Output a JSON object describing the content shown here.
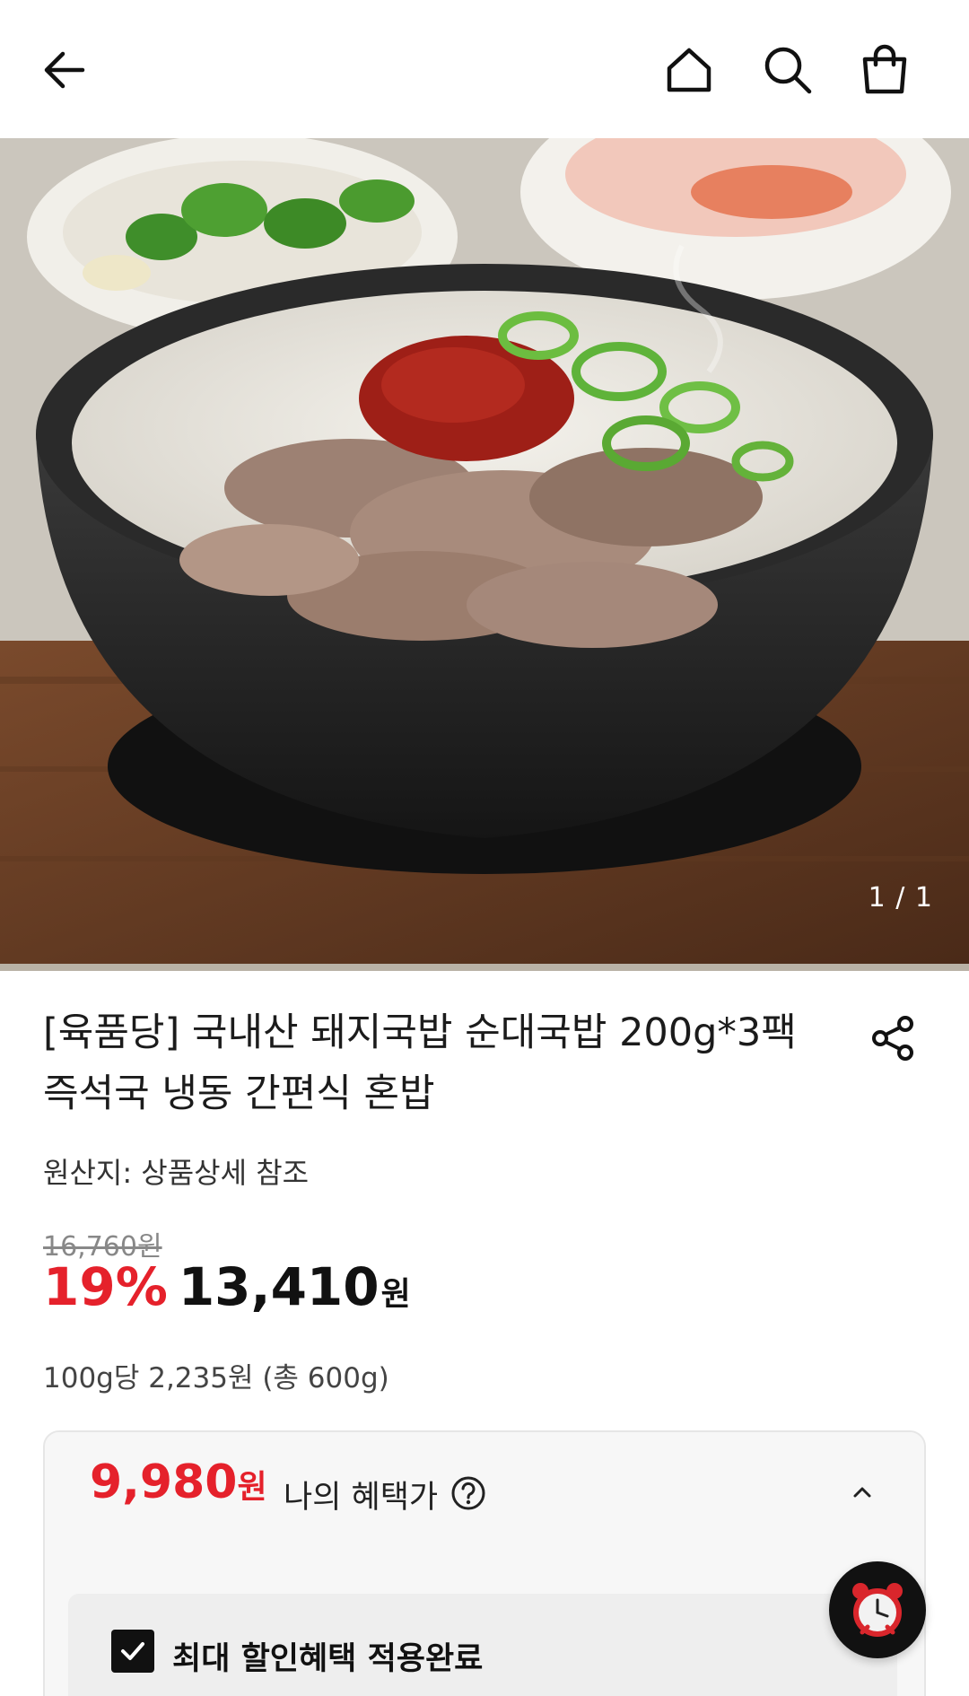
{
  "header": {
    "icons": [
      "back-arrow-icon",
      "home-icon",
      "search-icon",
      "shopping-bag-icon"
    ]
  },
  "hero": {
    "pager_text": "1 / 1"
  },
  "product": {
    "title": "[육품당] 국내산 돼지국밥 순대국밥 200g*3팩 즉석국 냉동 간편식 혼밥",
    "origin": "원산지: 상품상세 참조",
    "original_price": "16,760원",
    "discount_rate": "19%",
    "sale_price": "13,410",
    "sale_currency": "원",
    "unit_price": "100g당 2,235원 (총 600g)"
  },
  "benefit": {
    "price": "9,980",
    "currency": "원",
    "label": "나의 혜택가",
    "applied_label": "최대 할인혜택 적용완료"
  },
  "colors": {
    "accent": "#e5212b",
    "text": "#111111"
  }
}
